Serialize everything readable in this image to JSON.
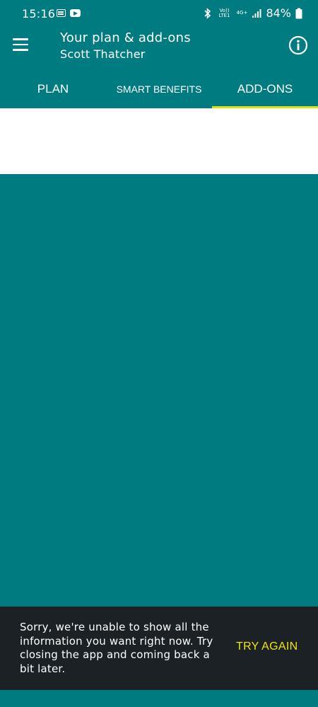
{
  "status_bar": {
    "time": "15:16",
    "volte": "Vo)) LTE1",
    "network": "4G+",
    "battery": "84%"
  },
  "header": {
    "title": "Your plan & add-ons",
    "subtitle": "Scott Thatcher",
    "menu_icon": "hamburger-menu-icon",
    "info_icon": "info-icon"
  },
  "tabs": [
    {
      "label": "PLAN",
      "active": false
    },
    {
      "label": "SMART BENEFITS",
      "active": false
    },
    {
      "label": "ADD-ONS",
      "active": true
    }
  ],
  "snackbar": {
    "message": "Sorry, we're unable to show all the information you want right now. Try closing the app and coming back a bit later.",
    "action": "TRY AGAIN"
  },
  "colors": {
    "primary": "#007B80",
    "accent": "#D7E10E",
    "snackbar_bg": "#1B2125",
    "snackbar_action": "#F2E500"
  }
}
